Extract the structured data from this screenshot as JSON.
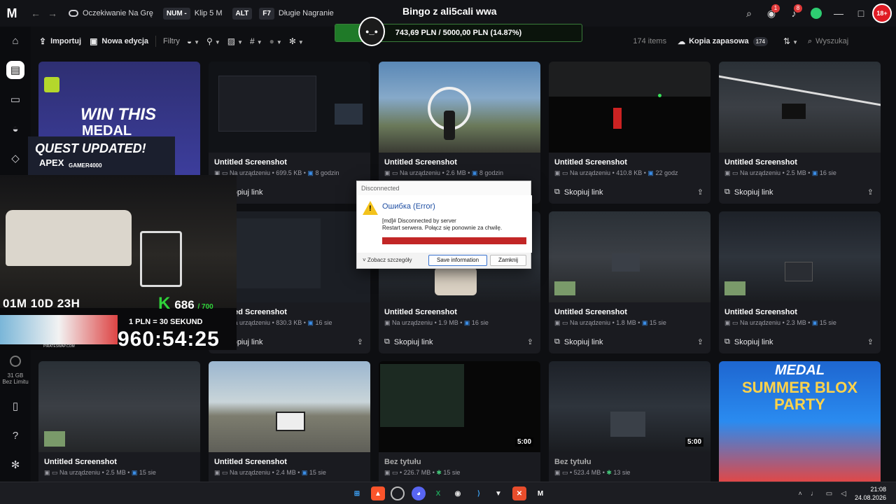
{
  "titlebar": {
    "logo": "M",
    "crumb": "Oczekiwanie Na Grę",
    "num_key": "NUM -",
    "clip_label": "Klip 5 M",
    "alt_key": "ALT",
    "f7_key": "F7",
    "long_rec_label": "Długie Nagranie",
    "center_title": "Bingo z ali5cali wwa",
    "badge_a": "1",
    "badge_b": "8",
    "avatar_text": "18+"
  },
  "progress": {
    "text": "743,69 PLN / 5000,00 PLN (14.87%)",
    "fraction": 0.1487,
    "color": "#1f7a28"
  },
  "sidebar": {
    "storage_size": "31 GB",
    "storage_limit": "Bez Limitu"
  },
  "toolbar": {
    "import_label": "Importuj",
    "new_edit_label": "Nowa edycja",
    "filters_label": "Filtry",
    "items_count": "174 items",
    "backup_label": "Kopia zapasowa",
    "backup_count": "174",
    "search_placeholder": "Wyszukaj"
  },
  "cards": [
    {
      "title": "",
      "meta": "",
      "age": "",
      "action": ""
    },
    {
      "title": "Untitled Screenshot",
      "location": "Na urządzeniu",
      "size": "699.5 KB",
      "age": "8 godzin",
      "action": "Skopiuj link"
    },
    {
      "title": "Untitled Screenshot",
      "location": "Na urządzeniu",
      "size": "2.6 MB",
      "age": "8 godzin",
      "action": "Skopiuj link"
    },
    {
      "title": "Untitled Screenshot",
      "location": "Na urządzeniu",
      "size": "410.8 KB",
      "age": "22 godz",
      "action": "Skopiuj link"
    },
    {
      "title": "Untitled Screenshot",
      "location": "Na urządzeniu",
      "size": "2.5 MB",
      "age": "16 sie",
      "action": "Skopiuj link"
    },
    {
      "title": "Untitled Screenshot",
      "location": "Na urządzeniu",
      "size": "830.3 KB",
      "age": "16 sie",
      "action": "Skopiuj link"
    },
    {
      "title": "Untitled Screenshot",
      "location": "Na urządzeniu",
      "size": "1.9 MB",
      "age": "16 sie",
      "action": "Skopiuj link"
    },
    {
      "title": "Untitled Screenshot",
      "location": "Na urządzeniu",
      "size": "1.8 MB",
      "age": "15 sie",
      "action": "Skopiuj link"
    },
    {
      "title": "Untitled Screenshot",
      "location": "Na urządzeniu",
      "size": "2.3 MB",
      "age": "15 sie",
      "action": "Skopiuj link"
    },
    {
      "title": "Untitled Screenshot",
      "location": "Na urządzeniu",
      "size": "2.5 MB",
      "age": "15 sie"
    },
    {
      "title": "Untitled Screenshot",
      "location": "Na urządzeniu",
      "size": "2.4 MB",
      "age": "15 sie"
    },
    {
      "title": "Bez tytułu",
      "location": "",
      "size": "226.7 MB",
      "age": "15 sie",
      "duration": "5:00"
    },
    {
      "title": "Bez tytułu",
      "location": "",
      "size": "523.4 MB",
      "age": "13 sie",
      "duration": "5:00"
    }
  ],
  "promo_cards": {
    "win_text": "WIN THIS",
    "medal_text": "MEDAL",
    "summer_title": "SUMMER BLOX PARTY",
    "summer_brand": "MEDAL"
  },
  "overlay": {
    "countdown": "01M 10D 23H",
    "k_label": "K",
    "k_count": "686",
    "k_total": "/ 700",
    "pln_rule": "1 PLN = 30 SEKUND",
    "big_timer": "960:54:25",
    "quest_text": "QUEST UPDATED!",
    "apex_text": "APEX",
    "gamer_text": "GAMER4000",
    "promo_url": "PIRATESWAP.COM"
  },
  "dialog": {
    "window_title": "Disconnected",
    "heading": "Ошибка (Error)",
    "line1": "[md]# Disconnected by server",
    "line2": "Restart serwera. Połącz się ponownie za chwilę.",
    "details_label": "Zobacz szczegóły",
    "save_button": "Save information",
    "close_button": "Zamknij"
  },
  "taskbar": {
    "time": "21:08",
    "date": "24.08.2026"
  },
  "colors": {
    "accent_green": "#2fd33a",
    "badge_red": "#e03a3a",
    "meta_blue": "#3b8ee8"
  }
}
